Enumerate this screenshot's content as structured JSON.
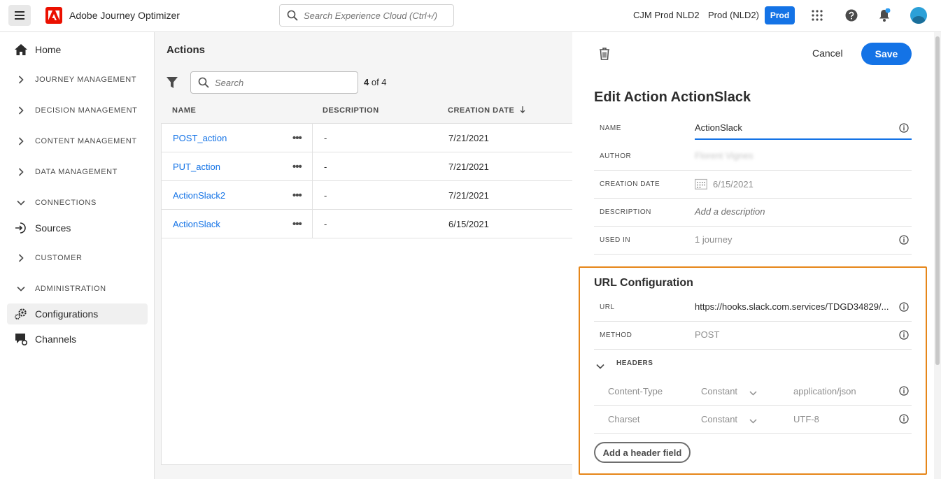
{
  "topbar": {
    "app_name": "Adobe Journey Optimizer",
    "search_placeholder": "Search Experience Cloud (Ctrl+/)",
    "org": "CJM Prod NLD2",
    "sandbox": "Prod (NLD2)",
    "env_badge": "Prod",
    "colors": {
      "brand": "#eb1000",
      "accent": "#1473e6"
    }
  },
  "sidebar": {
    "home": "Home",
    "journey_management": "JOURNEY MANAGEMENT",
    "decision_management": "DECISION MANAGEMENT",
    "content_management": "CONTENT MANAGEMENT",
    "data_management": "DATA MANAGEMENT",
    "connections": "CONNECTIONS",
    "sources": "Sources",
    "customer": "CUSTOMER",
    "administration": "ADMINISTRATION",
    "configurations": "Configurations",
    "channels": "Channels"
  },
  "main": {
    "title": "Actions",
    "search_placeholder": "Search",
    "count_shown": "4",
    "count_suffix": " of 4",
    "columns": {
      "name": "NAME",
      "description": "DESCRIPTION",
      "creation_date": "CREATION DATE"
    },
    "rows": [
      {
        "name": "POST_action",
        "description": "-",
        "date": "7/21/2021"
      },
      {
        "name": "PUT_action",
        "description": "-",
        "date": "7/21/2021"
      },
      {
        "name": "ActionSlack2",
        "description": "-",
        "date": "7/21/2021"
      },
      {
        "name": "ActionSlack",
        "description": "-",
        "date": "6/15/2021"
      }
    ]
  },
  "panel": {
    "cancel": "Cancel",
    "save": "Save",
    "title": "Edit Action ActionSlack",
    "fields": {
      "name_label": "NAME",
      "name_value": "ActionSlack",
      "author_label": "AUTHOR",
      "author_value": "Florent Vignes",
      "creation_date_label": "CREATION DATE",
      "creation_date_value": "6/15/2021",
      "description_label": "DESCRIPTION",
      "description_placeholder": "Add a description",
      "used_in_label": "USED IN",
      "used_in_value": "1 journey"
    },
    "url_config": {
      "title": "URL Configuration",
      "url_label": "URL",
      "url_value": "https://hooks.slack.com.services/TDGD34829/...",
      "method_label": "METHOD",
      "method_value": "POST",
      "headers_label": "HEADERS",
      "headers": [
        {
          "key": "Content-Type",
          "source": "Constant",
          "value": "application/json"
        },
        {
          "key": "Charset",
          "source": "Constant",
          "value": "UTF-8"
        }
      ],
      "add_header": "Add a header field",
      "highlight_color": "#e68619"
    }
  }
}
